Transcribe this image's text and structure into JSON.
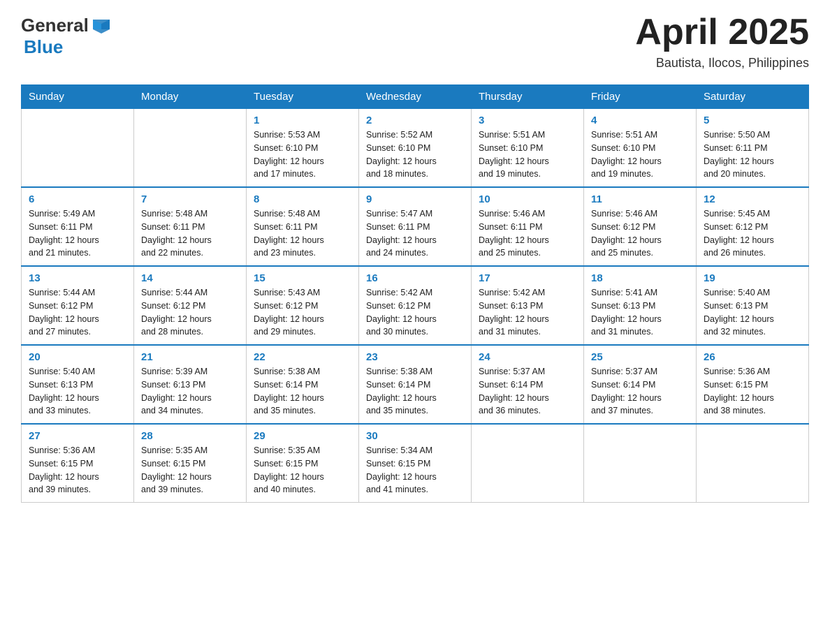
{
  "header": {
    "logo_general": "General",
    "logo_blue": "Blue",
    "title": "April 2025",
    "subtitle": "Bautista, Ilocos, Philippines"
  },
  "weekdays": [
    "Sunday",
    "Monday",
    "Tuesday",
    "Wednesday",
    "Thursday",
    "Friday",
    "Saturday"
  ],
  "weeks": [
    [
      {
        "day": "",
        "info": ""
      },
      {
        "day": "",
        "info": ""
      },
      {
        "day": "1",
        "info": "Sunrise: 5:53 AM\nSunset: 6:10 PM\nDaylight: 12 hours\nand 17 minutes."
      },
      {
        "day": "2",
        "info": "Sunrise: 5:52 AM\nSunset: 6:10 PM\nDaylight: 12 hours\nand 18 minutes."
      },
      {
        "day": "3",
        "info": "Sunrise: 5:51 AM\nSunset: 6:10 PM\nDaylight: 12 hours\nand 19 minutes."
      },
      {
        "day": "4",
        "info": "Sunrise: 5:51 AM\nSunset: 6:10 PM\nDaylight: 12 hours\nand 19 minutes."
      },
      {
        "day": "5",
        "info": "Sunrise: 5:50 AM\nSunset: 6:11 PM\nDaylight: 12 hours\nand 20 minutes."
      }
    ],
    [
      {
        "day": "6",
        "info": "Sunrise: 5:49 AM\nSunset: 6:11 PM\nDaylight: 12 hours\nand 21 minutes."
      },
      {
        "day": "7",
        "info": "Sunrise: 5:48 AM\nSunset: 6:11 PM\nDaylight: 12 hours\nand 22 minutes."
      },
      {
        "day": "8",
        "info": "Sunrise: 5:48 AM\nSunset: 6:11 PM\nDaylight: 12 hours\nand 23 minutes."
      },
      {
        "day": "9",
        "info": "Sunrise: 5:47 AM\nSunset: 6:11 PM\nDaylight: 12 hours\nand 24 minutes."
      },
      {
        "day": "10",
        "info": "Sunrise: 5:46 AM\nSunset: 6:11 PM\nDaylight: 12 hours\nand 25 minutes."
      },
      {
        "day": "11",
        "info": "Sunrise: 5:46 AM\nSunset: 6:12 PM\nDaylight: 12 hours\nand 25 minutes."
      },
      {
        "day": "12",
        "info": "Sunrise: 5:45 AM\nSunset: 6:12 PM\nDaylight: 12 hours\nand 26 minutes."
      }
    ],
    [
      {
        "day": "13",
        "info": "Sunrise: 5:44 AM\nSunset: 6:12 PM\nDaylight: 12 hours\nand 27 minutes."
      },
      {
        "day": "14",
        "info": "Sunrise: 5:44 AM\nSunset: 6:12 PM\nDaylight: 12 hours\nand 28 minutes."
      },
      {
        "day": "15",
        "info": "Sunrise: 5:43 AM\nSunset: 6:12 PM\nDaylight: 12 hours\nand 29 minutes."
      },
      {
        "day": "16",
        "info": "Sunrise: 5:42 AM\nSunset: 6:12 PM\nDaylight: 12 hours\nand 30 minutes."
      },
      {
        "day": "17",
        "info": "Sunrise: 5:42 AM\nSunset: 6:13 PM\nDaylight: 12 hours\nand 31 minutes."
      },
      {
        "day": "18",
        "info": "Sunrise: 5:41 AM\nSunset: 6:13 PM\nDaylight: 12 hours\nand 31 minutes."
      },
      {
        "day": "19",
        "info": "Sunrise: 5:40 AM\nSunset: 6:13 PM\nDaylight: 12 hours\nand 32 minutes."
      }
    ],
    [
      {
        "day": "20",
        "info": "Sunrise: 5:40 AM\nSunset: 6:13 PM\nDaylight: 12 hours\nand 33 minutes."
      },
      {
        "day": "21",
        "info": "Sunrise: 5:39 AM\nSunset: 6:13 PM\nDaylight: 12 hours\nand 34 minutes."
      },
      {
        "day": "22",
        "info": "Sunrise: 5:38 AM\nSunset: 6:14 PM\nDaylight: 12 hours\nand 35 minutes."
      },
      {
        "day": "23",
        "info": "Sunrise: 5:38 AM\nSunset: 6:14 PM\nDaylight: 12 hours\nand 35 minutes."
      },
      {
        "day": "24",
        "info": "Sunrise: 5:37 AM\nSunset: 6:14 PM\nDaylight: 12 hours\nand 36 minutes."
      },
      {
        "day": "25",
        "info": "Sunrise: 5:37 AM\nSunset: 6:14 PM\nDaylight: 12 hours\nand 37 minutes."
      },
      {
        "day": "26",
        "info": "Sunrise: 5:36 AM\nSunset: 6:15 PM\nDaylight: 12 hours\nand 38 minutes."
      }
    ],
    [
      {
        "day": "27",
        "info": "Sunrise: 5:36 AM\nSunset: 6:15 PM\nDaylight: 12 hours\nand 39 minutes."
      },
      {
        "day": "28",
        "info": "Sunrise: 5:35 AM\nSunset: 6:15 PM\nDaylight: 12 hours\nand 39 minutes."
      },
      {
        "day": "29",
        "info": "Sunrise: 5:35 AM\nSunset: 6:15 PM\nDaylight: 12 hours\nand 40 minutes."
      },
      {
        "day": "30",
        "info": "Sunrise: 5:34 AM\nSunset: 6:15 PM\nDaylight: 12 hours\nand 41 minutes."
      },
      {
        "day": "",
        "info": ""
      },
      {
        "day": "",
        "info": ""
      },
      {
        "day": "",
        "info": ""
      }
    ]
  ]
}
